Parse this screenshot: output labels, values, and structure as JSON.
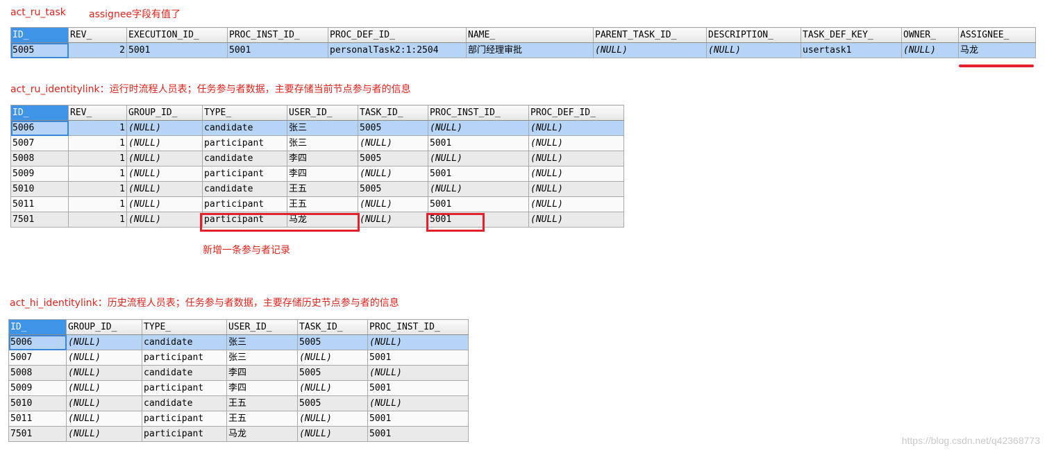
{
  "notes": {
    "task_title": "act_ru_task",
    "task_note": "assignee字段有值了",
    "ru_identity_title": "act_ru_identitylink：运行时流程人员表；任务参与者数据，主要存储当前节点参与者的信息",
    "added_note": "新增一条参与者记录",
    "hi_identity_title": "act_hi_identitylink：历史流程人员表；任务参与者数据，主要存储历史节点参与者的信息"
  },
  "task_table": {
    "columns": [
      "ID_",
      "REV_",
      "EXECUTION_ID_",
      "PROC_INST_ID_",
      "PROC_DEF_ID_",
      "NAME_",
      "PARENT_TASK_ID_",
      "DESCRIPTION_",
      "TASK_DEF_KEY_",
      "OWNER_",
      "ASSIGNEE_"
    ],
    "rows": [
      [
        "5005",
        "2",
        "5001",
        "5001",
        "personalTask2:1:2504",
        "部门经理审批",
        "(NULL)",
        "(NULL)",
        "usertask1",
        "(NULL)",
        "马龙"
      ]
    ]
  },
  "ru_identity_table": {
    "columns": [
      "ID_",
      "REV_",
      "GROUP_ID_",
      "TYPE_",
      "USER_ID_",
      "TASK_ID_",
      "PROC_INST_ID_",
      "PROC_DEF_ID_"
    ],
    "rows": [
      [
        "5006",
        "1",
        "(NULL)",
        "candidate",
        "张三",
        "5005",
        "(NULL)",
        "(NULL)"
      ],
      [
        "5007",
        "1",
        "(NULL)",
        "participant",
        "张三",
        "(NULL)",
        "5001",
        "(NULL)"
      ],
      [
        "5008",
        "1",
        "(NULL)",
        "candidate",
        "李四",
        "5005",
        "(NULL)",
        "(NULL)"
      ],
      [
        "5009",
        "1",
        "(NULL)",
        "participant",
        "李四",
        "(NULL)",
        "5001",
        "(NULL)"
      ],
      [
        "5010",
        "1",
        "(NULL)",
        "candidate",
        "王五",
        "5005",
        "(NULL)",
        "(NULL)"
      ],
      [
        "5011",
        "1",
        "(NULL)",
        "participant",
        "王五",
        "(NULL)",
        "5001",
        "(NULL)"
      ],
      [
        "7501",
        "1",
        "(NULL)",
        "participant",
        "马龙",
        "(NULL)",
        "5001",
        "(NULL)"
      ]
    ]
  },
  "hi_identity_table": {
    "columns": [
      "ID_",
      "GROUP_ID_",
      "TYPE_",
      "USER_ID_",
      "TASK_ID_",
      "PROC_INST_ID_"
    ],
    "rows": [
      [
        "5006",
        "(NULL)",
        "candidate",
        "张三",
        "5005",
        "(NULL)"
      ],
      [
        "5007",
        "(NULL)",
        "participant",
        "张三",
        "(NULL)",
        "5001"
      ],
      [
        "5008",
        "(NULL)",
        "candidate",
        "李四",
        "5005",
        "(NULL)"
      ],
      [
        "5009",
        "(NULL)",
        "participant",
        "李四",
        "(NULL)",
        "5001"
      ],
      [
        "5010",
        "(NULL)",
        "candidate",
        "王五",
        "5005",
        "(NULL)"
      ],
      [
        "5011",
        "(NULL)",
        "participant",
        "王五",
        "(NULL)",
        "5001"
      ],
      [
        "7501",
        "(NULL)",
        "participant",
        "马龙",
        "(NULL)",
        "5001"
      ]
    ]
  },
  "watermark": "https://blog.csdn.net/q42368773",
  "colors": {
    "annotation": "#e0241c",
    "highlight_box": "#e4202a",
    "selected_row": "#b6d5f6",
    "active_header": "#3e94e6"
  }
}
